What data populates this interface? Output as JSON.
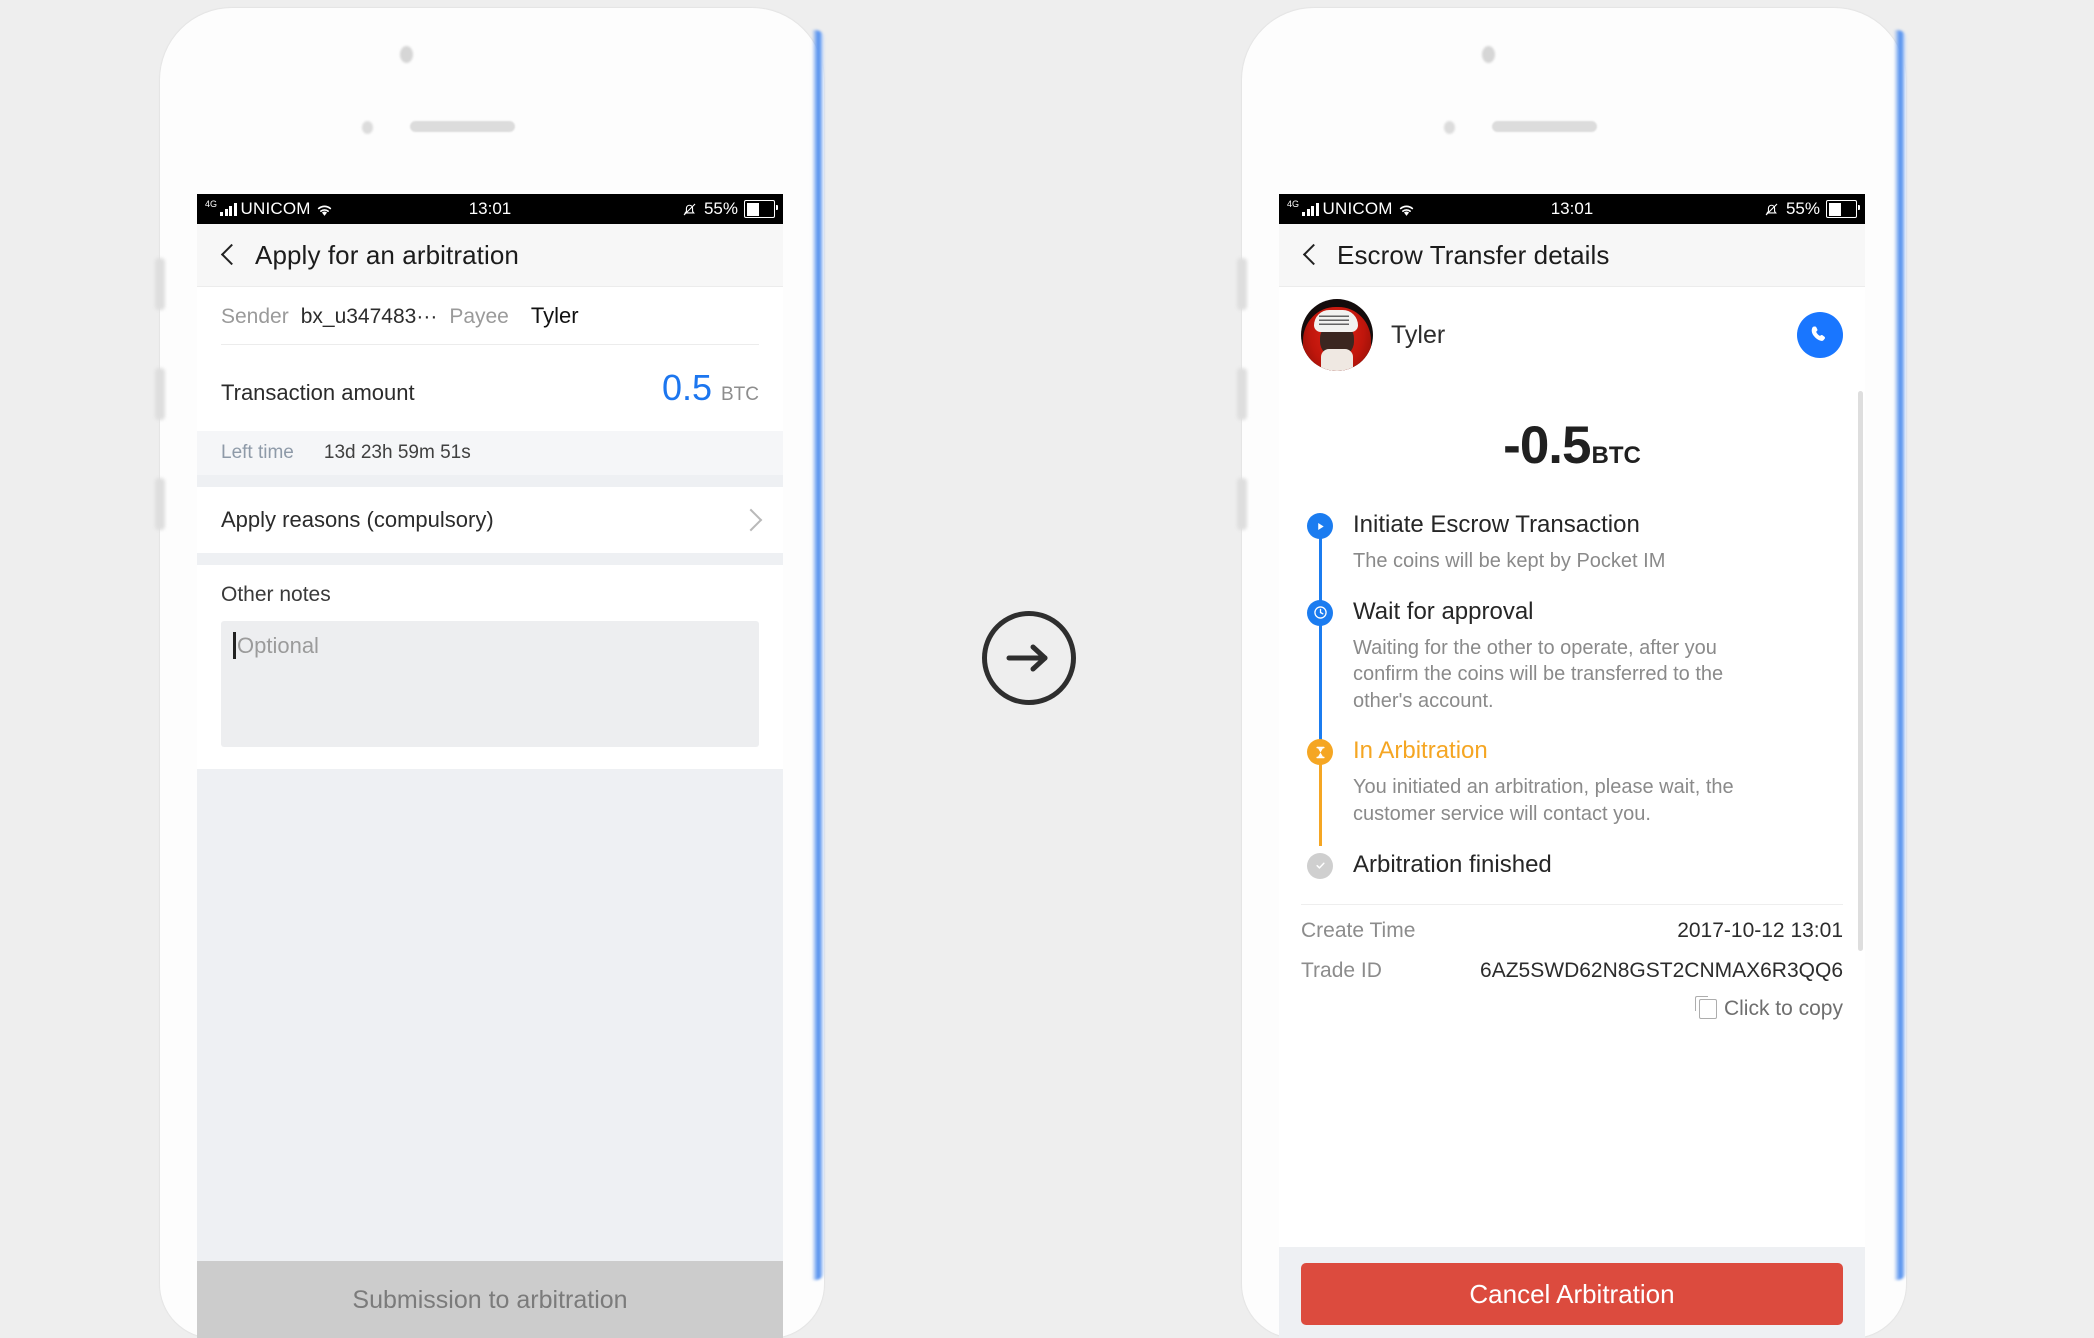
{
  "status_bar": {
    "network_type": "4G",
    "carrier": "UNICOM",
    "time": "13:01",
    "battery_percent": "55%",
    "icons": {
      "signal": "signal-bars-icon",
      "wifi": "wifi-icon",
      "mute": "bell-muted-icon",
      "battery": "battery-icon"
    }
  },
  "left_screen": {
    "nav": {
      "back_icon": "back-chevron-icon",
      "title": "Apply for an arbitration"
    },
    "sender": {
      "label": "Sender",
      "value": "bx_u347483···"
    },
    "payee": {
      "label": "Payee",
      "value": "Tyler"
    },
    "amount": {
      "label": "Transaction amount",
      "value": "0.5",
      "unit": "BTC",
      "color": "#1c76ef"
    },
    "left_time": {
      "label": "Left time",
      "value": "13d 23h 59m 51s"
    },
    "apply_reasons": {
      "label": "Apply reasons (compulsory)",
      "chevron": "chevron-right-icon"
    },
    "other_notes": {
      "label": "Other notes",
      "placeholder": "Optional",
      "value": ""
    },
    "submit": {
      "label": "Submission to arbitration",
      "enabled": false,
      "bg": "#cccccc",
      "fg": "#7b7b7b"
    }
  },
  "right_screen": {
    "nav": {
      "back_icon": "back-chevron-icon",
      "title": "Escrow Transfer details"
    },
    "contact": {
      "name": "Tyler",
      "avatar": "user-avatar",
      "call_icon": "phone-call-icon",
      "call_bg": "#1976ff"
    },
    "amount": {
      "value": "-0.5",
      "unit": "BTC"
    },
    "timeline": [
      {
        "title": "Initiate Escrow Transaction",
        "desc": "The coins will be kept by Pocket IM",
        "icon": "play-circle-icon",
        "state": "done",
        "color": "#1b7cf0"
      },
      {
        "title": "Wait for approval",
        "desc": "Waiting for the other to operate, after you confirm the coins will be transferred to the other's account.",
        "icon": "clock-circle-icon",
        "state": "done",
        "color": "#1b7cf0"
      },
      {
        "title": "In Arbitration",
        "desc": "You initiated an arbitration, please wait, the customer service will contact you.",
        "icon": "hourglass-circle-icon",
        "state": "active",
        "color": "#f5a623"
      },
      {
        "title": "Arbitration finished",
        "desc": "",
        "icon": "check-circle-icon",
        "state": "pending",
        "color": "#cfcfcf"
      }
    ],
    "create_time": {
      "label": "Create Time",
      "value": "2017-10-12 13:01"
    },
    "trade_id": {
      "label": "Trade ID",
      "value": "6AZ5SWD62N8GST2CNMAX6R3QQ6"
    },
    "copy": {
      "label": "Click to copy",
      "icon": "copy-icon"
    },
    "cancel": {
      "label": "Cancel Arbitration",
      "bg": "#dc4b3e",
      "fg": "#ffffff"
    }
  },
  "transition": {
    "icon": "arrow-right-circle-icon"
  }
}
